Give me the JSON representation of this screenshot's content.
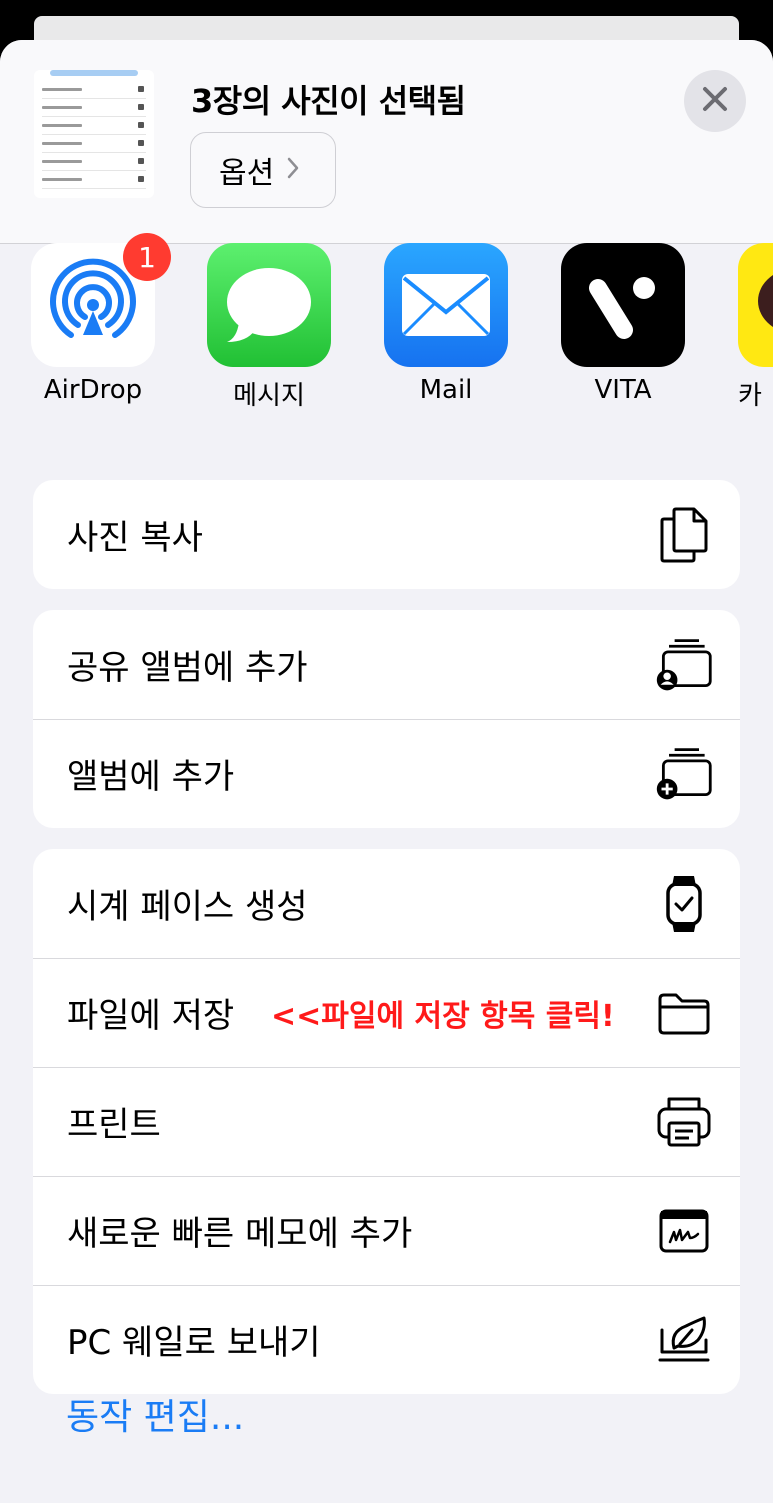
{
  "header": {
    "title": "3장의 사진이 선택됨",
    "options_label": "옵션"
  },
  "apps": [
    {
      "name": "AirDrop",
      "icon": "airdrop-icon",
      "badge": "1",
      "color": "#1a7cf5"
    },
    {
      "name": "메시지",
      "icon": "messages-icon",
      "color": "#34c759"
    },
    {
      "name": "Mail",
      "icon": "mail-icon",
      "color": "#1a8cff"
    },
    {
      "name": "VITA",
      "icon": "vita-icon",
      "color": "#000000"
    },
    {
      "name": "카",
      "icon": "kakaotalk-icon",
      "color": "#ffe812"
    }
  ],
  "actions": {
    "copy_photos": "사진 복사",
    "add_shared_album": "공유 앨범에 추가",
    "add_album": "앨범에 추가",
    "watch_face": "시계 페이스 생성",
    "save_files": "파일에 저장",
    "save_files_note": "<<파일에 저장 항목 클릭!",
    "print": "프린트",
    "quick_note": "새로운 빠른 메모에 추가",
    "pc_whale": "PC 웨일로 보내기"
  },
  "edit_actions": "동작 편집..."
}
